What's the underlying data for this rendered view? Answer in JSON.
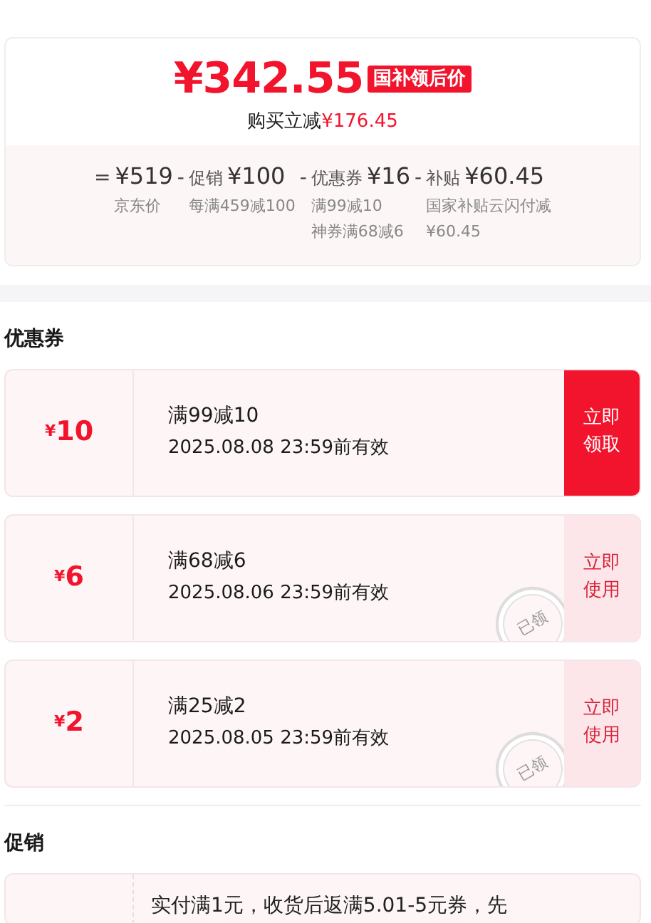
{
  "price_card": {
    "final_price": "¥342.55",
    "price_tag": "国补领后价",
    "saving_label": "购买立减",
    "saving_amount": "¥176.45",
    "breakdown": [
      {
        "operator": "=",
        "amount": "¥519",
        "notes": [
          "京东价"
        ]
      },
      {
        "operator": "-",
        "label": "促销",
        "amount": "¥100",
        "notes": [
          "每满459减100"
        ]
      },
      {
        "operator": "-",
        "label": "优惠券",
        "amount": "¥16",
        "notes": [
          "满99减10",
          "神券满68减6"
        ]
      },
      {
        "operator": "-",
        "label": "补贴",
        "amount": "¥60.45",
        "notes": [
          "国家补贴云闪付减",
          "¥60.45"
        ]
      }
    ]
  },
  "coupons_section": {
    "title": "优惠券",
    "coupons": [
      {
        "currency": "¥",
        "value": "10",
        "condition": "满99减10",
        "validity": "2025.08.08 23:59前有效",
        "action": "立即领取",
        "claimed": false
      },
      {
        "currency": "¥",
        "value": "6",
        "condition": "满68减6",
        "validity": "2025.08.06 23:59前有效",
        "action": "立即使用",
        "claimed": true,
        "stamp": "已领"
      },
      {
        "currency": "¥",
        "value": "2",
        "condition": "满25减2",
        "validity": "2025.08.05 23:59前有效",
        "action": "立即使用",
        "claimed": true,
        "stamp": "已领"
      }
    ]
  },
  "promotions_section": {
    "title": "促销",
    "promotions": [
      {
        "text": "实付满1元，收货后返满5.01-5元券，先"
      }
    ]
  }
}
